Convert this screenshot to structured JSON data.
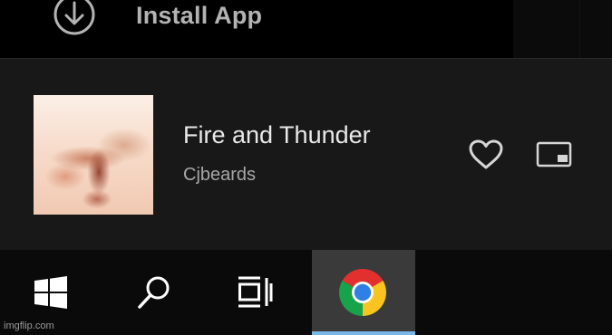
{
  "install": {
    "icon": "download-circle-icon",
    "label": "Install App"
  },
  "now_playing": {
    "cover_art": "album-cover-image",
    "title": "Fire and Thunder",
    "artist": "Cjbeards",
    "like_icon": "heart-icon",
    "miniplayer_icon": "picture-in-picture-icon"
  },
  "taskbar": {
    "items": [
      {
        "icon": "windows-start-icon"
      },
      {
        "icon": "search-icon"
      },
      {
        "icon": "task-view-icon"
      },
      {
        "icon": "chrome-icon",
        "active": true
      }
    ],
    "active_indicator_color": "#77b8e8"
  },
  "watermark": "imgflip.com"
}
